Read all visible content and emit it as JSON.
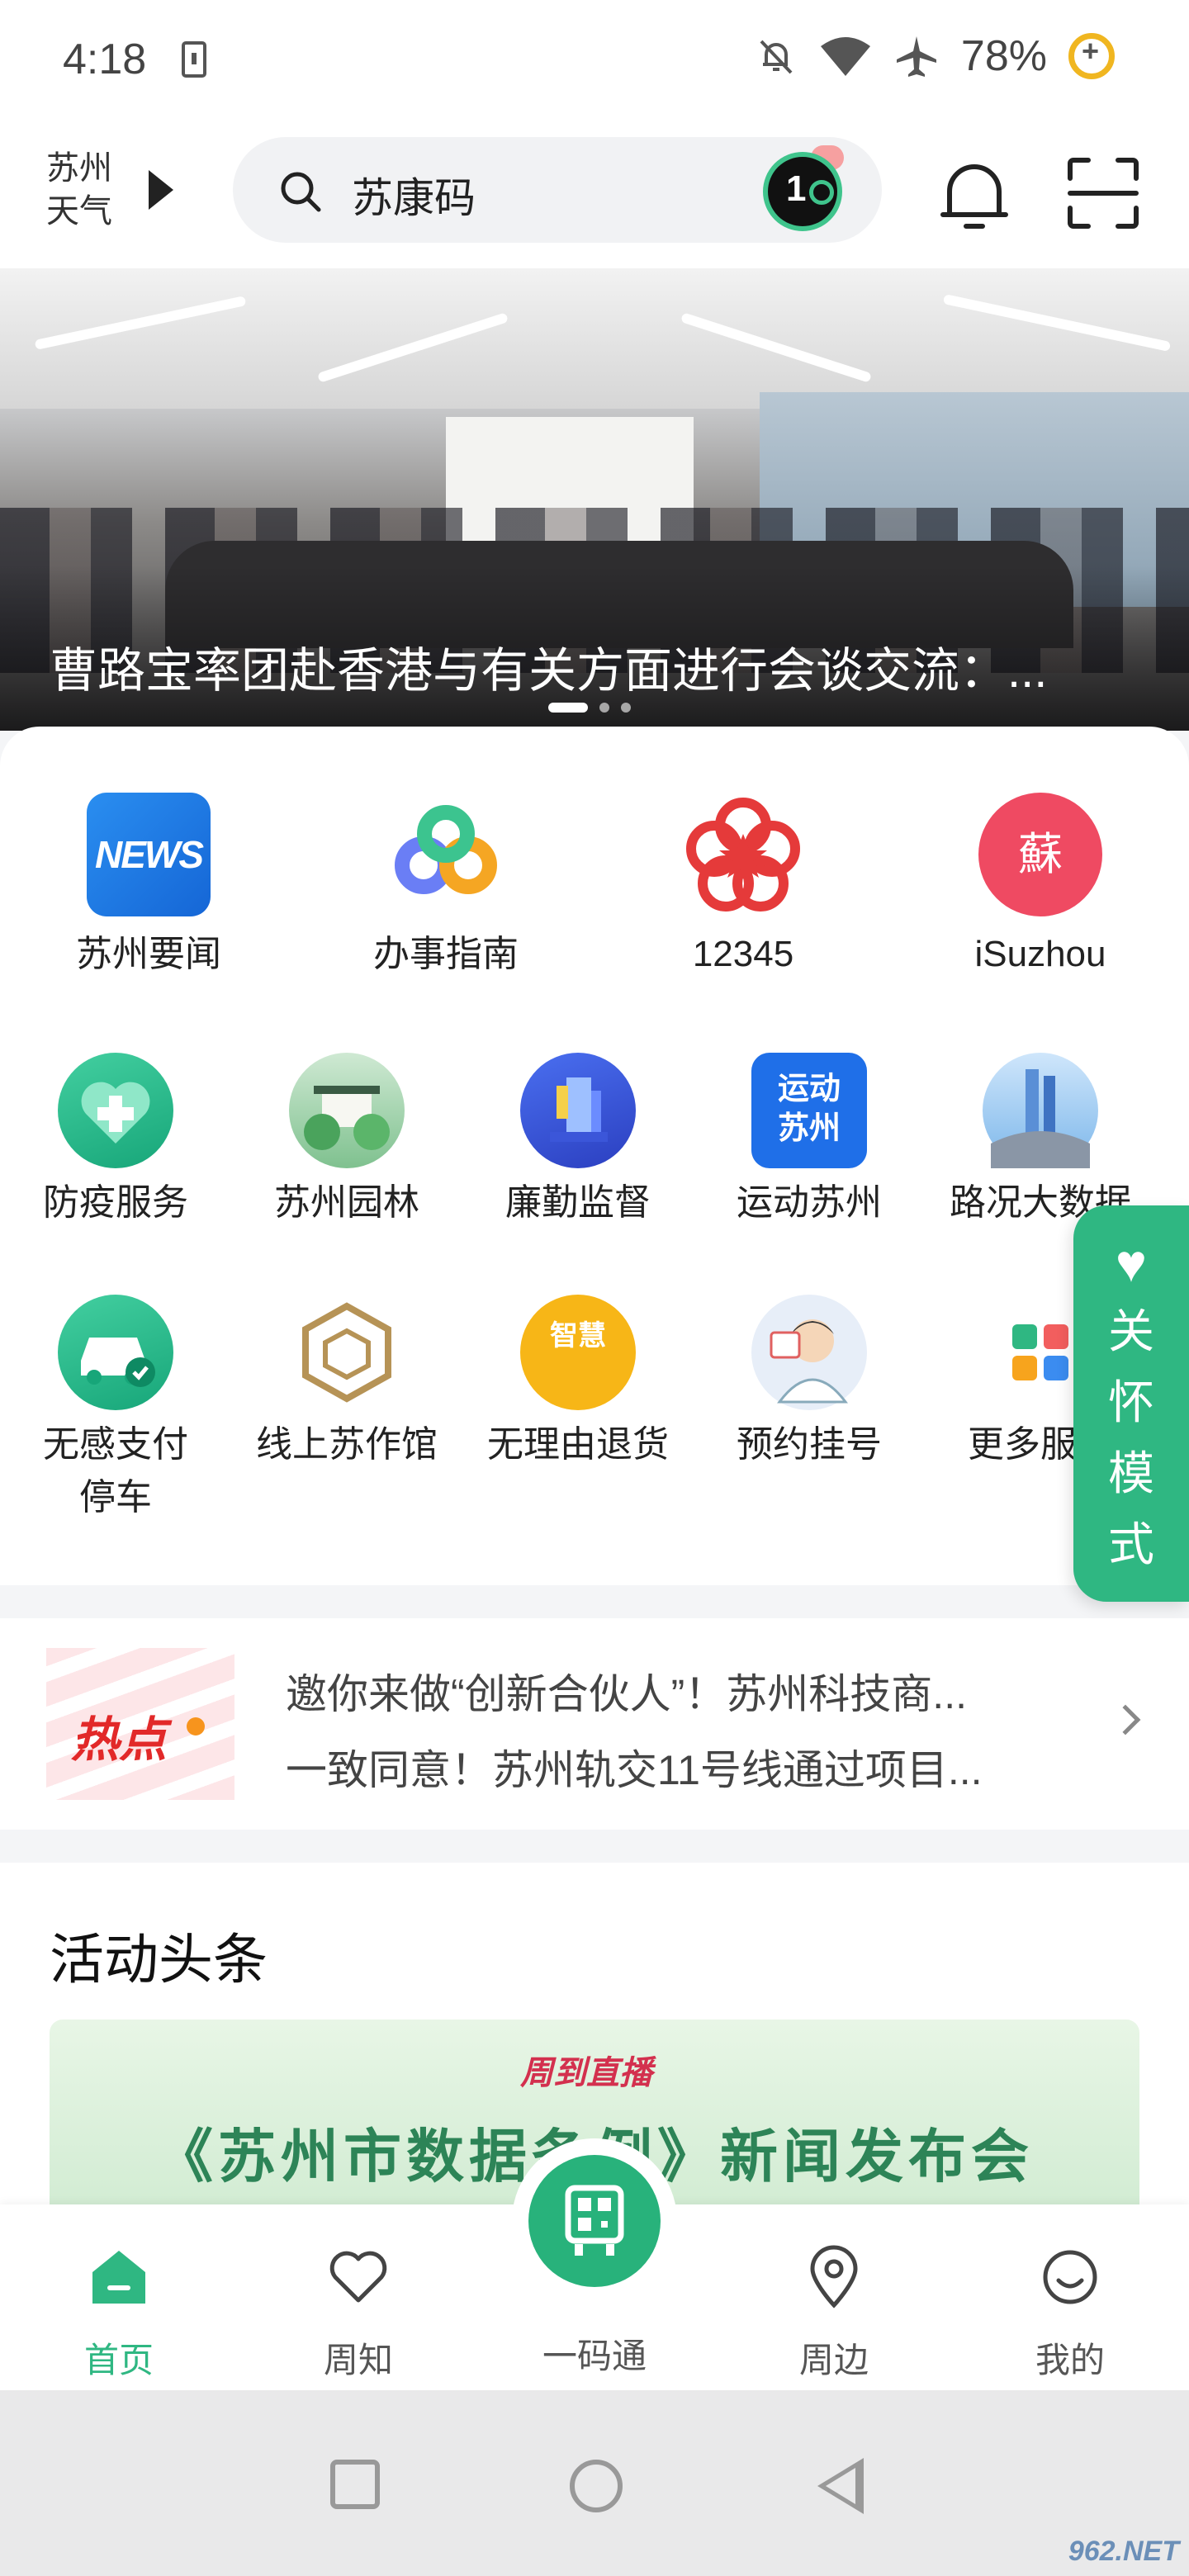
{
  "status_bar": {
    "time": "4:18",
    "battery": "78%"
  },
  "header": {
    "weather_label": "苏州\n天气",
    "search_text": "苏康码"
  },
  "banner": {
    "title": "曹路宝率团赴香港与有关方面进行会谈交流：..."
  },
  "services_top": [
    {
      "label": "苏州要闻",
      "icon": "news-icon"
    },
    {
      "label": "办事指南",
      "icon": "guide-icon"
    },
    {
      "label": "12345",
      "icon": "hotline-flower-icon"
    },
    {
      "label": "iSuzhou",
      "icon": "isuzhou-icon"
    }
  ],
  "services_row2": [
    {
      "label": "防疫服务",
      "icon": "health-heart-icon"
    },
    {
      "label": "苏州园林",
      "icon": "garden-icon"
    },
    {
      "label": "廉勤监督",
      "icon": "supervision-icon"
    },
    {
      "label": "运动苏州",
      "icon": "sports-icon"
    },
    {
      "label": "路况大数据",
      "icon": "traffic-icon"
    }
  ],
  "services_row3": [
    {
      "label": "无感支付\n停车",
      "icon": "parking-car-icon"
    },
    {
      "label": "线上苏作馆",
      "icon": "craft-hall-icon"
    },
    {
      "label": "无理由退货",
      "icon": "wisdom-return-icon"
    },
    {
      "label": "预约挂号",
      "icon": "doctor-icon"
    },
    {
      "label": "更多服务",
      "icon": "more-apps-icon"
    }
  ],
  "icon_texts": {
    "news": "NEWS",
    "sports": "运动\n苏州",
    "isuzhou": "蘇",
    "wisdom": "智慧"
  },
  "care_mode": {
    "label": "关怀模式"
  },
  "hot": {
    "badge": "热点",
    "lines": [
      "邀你来做“创新合伙人”！苏州科技商...",
      "一致同意！苏州轨交11号线通过项目..."
    ]
  },
  "activity": {
    "title": "活动头条",
    "logo": "周到直播",
    "headline": "《苏州市数据条例》新闻发布会"
  },
  "tabs": [
    {
      "label": "首页",
      "active": true
    },
    {
      "label": "周知"
    },
    {
      "label": "一码通"
    },
    {
      "label": "周边"
    },
    {
      "label": "我的"
    }
  ],
  "colors": {
    "accent": "#2fb782",
    "hot_red": "#e22929"
  },
  "watermark": "962.NET"
}
